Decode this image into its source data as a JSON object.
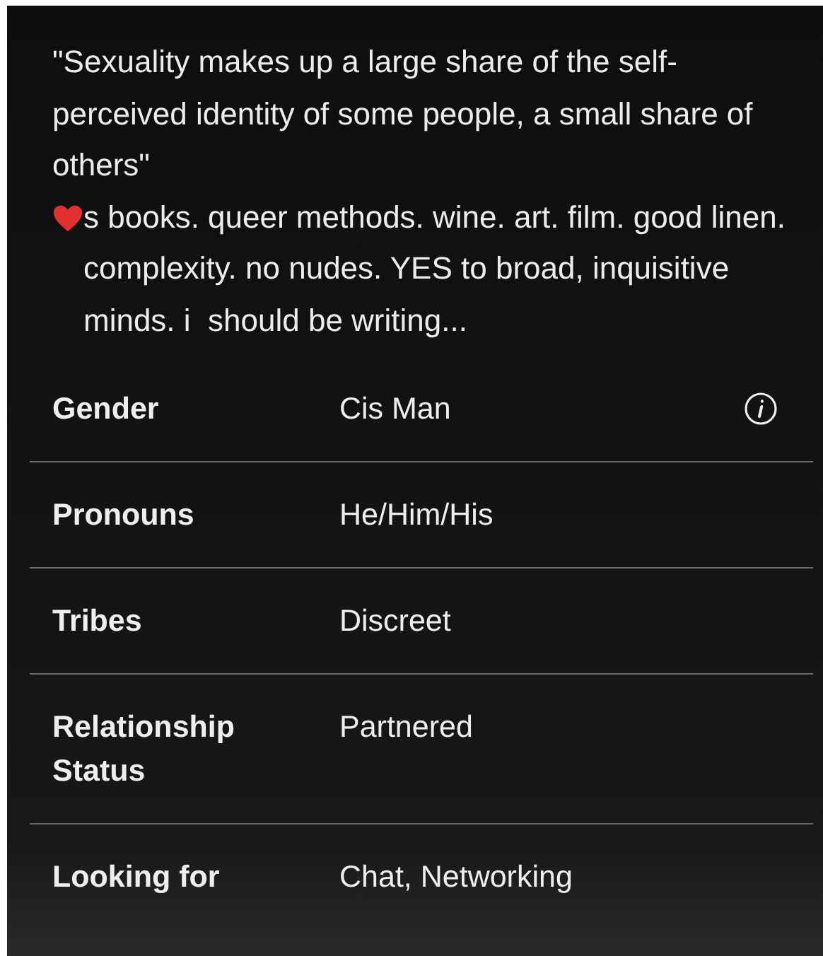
{
  "bio": {
    "quote": "\"Sexuality makes up a large share of the self-perceived identity of some people, a small share of others\"",
    "after_heart": "s books. queer methods. wine. art. film. good linen. complexity. no nudes. YES to broad, inquisitive minds. i  should be writing..."
  },
  "details": [
    {
      "label": "Gender",
      "value": "Cis Man",
      "info": true
    },
    {
      "label": "Pronouns",
      "value": "He/Him/His",
      "info": false
    },
    {
      "label": "Tribes",
      "value": "Discreet",
      "info": false
    },
    {
      "label": "Relationship Status",
      "value": "Partnered",
      "info": false
    },
    {
      "label": "Looking for",
      "value": "Chat, Networking",
      "info": false
    }
  ]
}
